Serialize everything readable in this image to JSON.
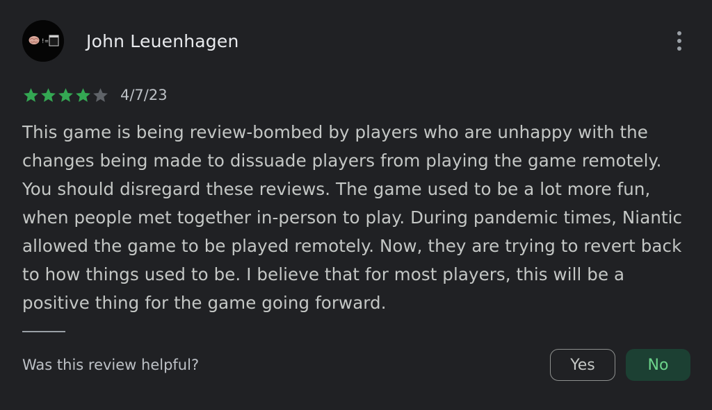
{
  "review": {
    "author": "John Leuenhagen",
    "avatar_icon": "brain-terminal-avatar",
    "rating": 4,
    "rating_max": 5,
    "date": "4/7/23",
    "text": "This game is being review-bombed by players who are unhappy with the changes being made to dissuade players from playing the game remotely. You should disregard these reviews. The game used to be a lot more fun, when people met together in-person to play. During pandemic times, Niantic allowed the game to be played remotely. Now, they are trying to revert back to how things used to be. I believe that for most players, this will be a positive thing for the game going forward.",
    "more_icon": "more-vert-icon"
  },
  "helpful": {
    "question": "Was this review helpful?",
    "yes_label": "Yes",
    "no_label": "No"
  },
  "colors": {
    "background": "#202124",
    "star_filled": "#34a853",
    "star_empty": "#5f6368",
    "no_button_bg": "#1c4033",
    "no_button_text": "#6dd58c"
  }
}
